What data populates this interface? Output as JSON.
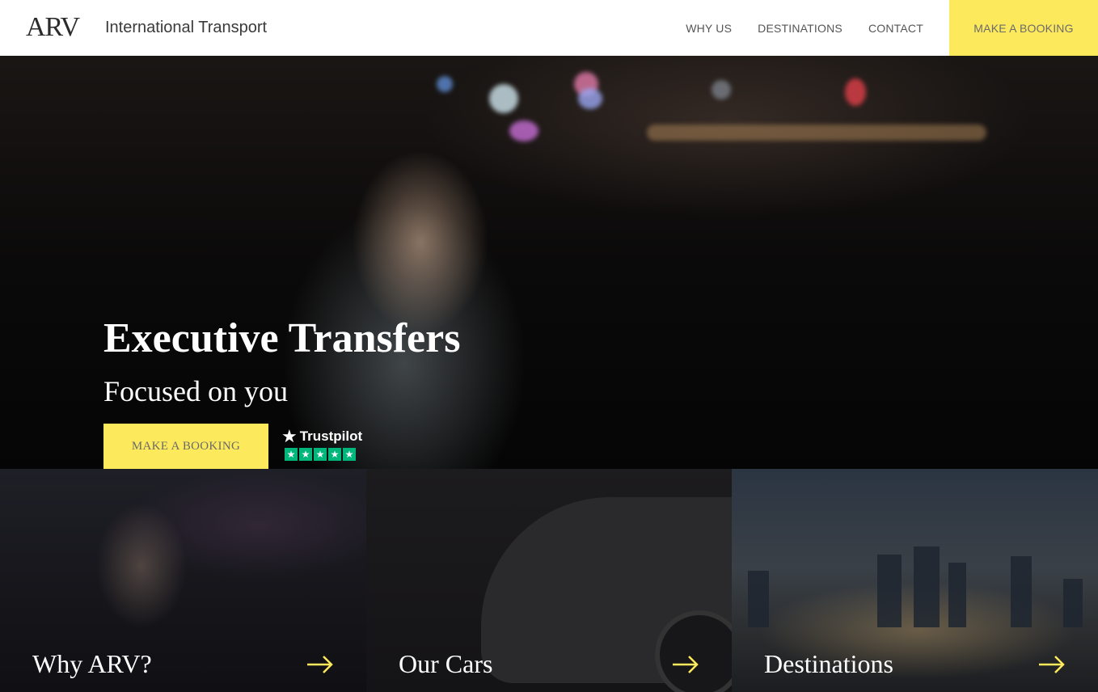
{
  "header": {
    "logo_text": "ARV",
    "tagline": "International Transport",
    "nav": [
      {
        "label": "WHY US"
      },
      {
        "label": "DESTINATIONS"
      },
      {
        "label": "CONTACT"
      }
    ],
    "cta_label": "MAKE A BOOKING"
  },
  "hero": {
    "title": "Executive Transfers",
    "subtitle": "Focused on you",
    "button_label": "MAKE A BOOKING",
    "trustpilot": {
      "label": "Trustpilot",
      "stars": 5
    }
  },
  "tiles": [
    {
      "label": "Why ARV?"
    },
    {
      "label": "Our Cars"
    },
    {
      "label": "Destinations"
    }
  ],
  "colors": {
    "accent": "#fde95c",
    "trustpilot_green": "#00b67a",
    "arrow": "#fde95c"
  },
  "icons": {
    "trustpilot_logo": "trustpilot-star-icon",
    "tile_arrow": "arrow-right-icon"
  }
}
